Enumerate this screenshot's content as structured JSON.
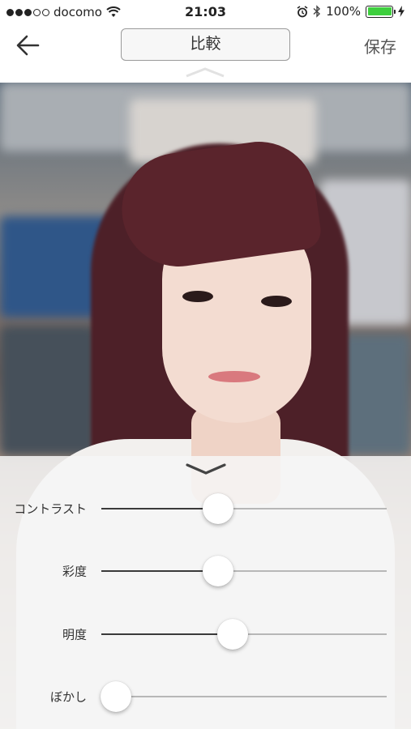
{
  "status_bar": {
    "carrier": "docomo",
    "time": "21:03",
    "battery": "100%",
    "signal_bars_filled": 3,
    "signal_bars_total": 5,
    "icons": [
      "signal-dots-icon",
      "wifi-icon",
      "alarm-icon",
      "bluetooth-icon",
      "battery-icon",
      "charging-icon"
    ]
  },
  "nav": {
    "back_icon": "arrow-left-icon",
    "compare_label": "比較",
    "save_label": "保存"
  },
  "sliders": [
    {
      "label": "コントラスト",
      "value": 0.41
    },
    {
      "label": "彩度",
      "value": 0.41
    },
    {
      "label": "明度",
      "value": 0.46
    },
    {
      "label": "ぼかし",
      "value": 0.05
    }
  ],
  "colors": {
    "accent": "#3a3a3a",
    "track": "#b7b7b7",
    "battery": "#3ecf3e"
  }
}
